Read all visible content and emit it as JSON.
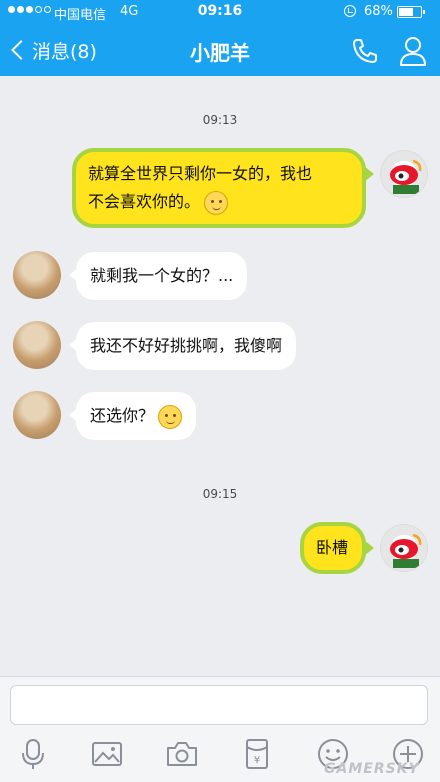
{
  "status_bar": {
    "carrier": "中国电信",
    "network": "4G",
    "time": "09:16",
    "battery_pct": "68%",
    "battery_level": 0.68
  },
  "header": {
    "back_label": "消息(8)",
    "title": "小肥羊"
  },
  "chat": {
    "time_1": "09:13",
    "time_2": "09:15",
    "messages": [
      {
        "sender": "me",
        "line1": "就算全世界只剩你一女的，我也",
        "line2": "不会喜欢你的。"
      },
      {
        "sender": "other",
        "text": "就剩我一个女的？..."
      },
      {
        "sender": "other",
        "text": "我还不好好挑挑啊，我傻啊"
      },
      {
        "sender": "other",
        "text": "还选你？"
      },
      {
        "sender": "me",
        "text": "卧槽"
      }
    ]
  },
  "colors": {
    "header": "#1aa3f0",
    "bubble_me_fill": "#ffe31c",
    "bubble_me_border": "#a6d53f",
    "bubble_other": "#ffffff",
    "background": "#ebedf1"
  },
  "toolbar_icons": [
    "microphone-icon",
    "image-icon",
    "camera-icon",
    "red-packet-icon",
    "emoji-icon",
    "plus-icon"
  ],
  "watermark": "GAMERSKY"
}
